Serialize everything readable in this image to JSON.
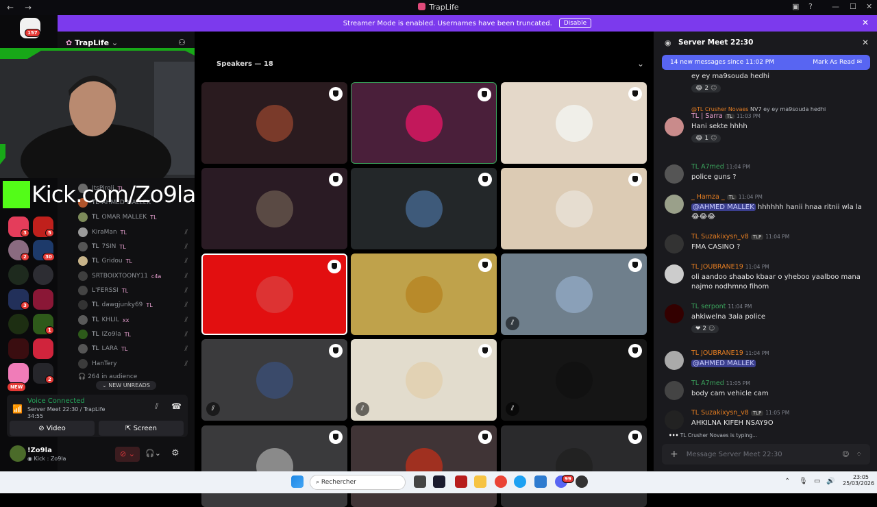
{
  "window": {
    "title": "TrapLife",
    "back": "←",
    "forward": "→",
    "minimize": "—",
    "maximize": "☐",
    "close": "✕"
  },
  "banner": {
    "text": "Streamer Mode is enabled. Usernames have been truncated.",
    "disable_label": "Disable",
    "close": "✕"
  },
  "rail": {
    "home_badge": "157",
    "new_label": "NEW",
    "badges": [
      "3",
      "5",
      "2",
      "30",
      "3",
      "1",
      "2"
    ]
  },
  "guild": {
    "name": "TrapLife"
  },
  "overlay": {
    "kick_text": "Kick.com/Zo9la"
  },
  "stage": {
    "title": "Speakers — 18"
  },
  "members": [
    {
      "prefix": "",
      "name": "ItsPiroli",
      "tag": "TL"
    },
    {
      "prefix": "TL",
      "name": "AHMED MALLEK",
      "tag": ""
    },
    {
      "prefix": "TL",
      "name": "OMAR MALLEK",
      "tag": "TL"
    },
    {
      "prefix": "",
      "name": "KiraMan",
      "tag": "TL"
    },
    {
      "prefix": "TL",
      "name": "7SIN",
      "tag": "TL"
    },
    {
      "prefix": "TL",
      "name": "Gridou",
      "tag": "TL"
    },
    {
      "prefix": "",
      "name": "SRTBOIXTOONY11",
      "tag": "c4a"
    },
    {
      "prefix": "",
      "name": "L'FERSSI",
      "tag": "TL"
    },
    {
      "prefix": "TL",
      "name": "dawgjunky69",
      "tag": "TL"
    },
    {
      "prefix": "TL",
      "name": "KHLIL",
      "tag": "xx"
    },
    {
      "prefix": "TL",
      "name": "IZo9la",
      "tag": "TL"
    },
    {
      "prefix": "TL",
      "name": "LARA",
      "tag": "TL"
    },
    {
      "prefix": "",
      "name": "HanTery",
      "tag": ""
    }
  ],
  "audience": "264 in audience",
  "new_unreads": "NEW UNREADS",
  "voice": {
    "status": "Voice Connected",
    "channel": "Server Meet 22:30 / TrapLife",
    "timer": "34:55",
    "video_label": "Video",
    "screen_label": "Screen"
  },
  "user": {
    "name": "!Zo9la",
    "status": "Kick : Zo9la"
  },
  "chat": {
    "title": "Server Meet 22:30",
    "new_messages": "14 new messages since 11:02 PM",
    "mark_read": "Mark As Read",
    "messages": [
      {
        "text": "ey ey ma9souda hedhi",
        "reaction": "2"
      },
      {
        "reply": "@TL Crusher Novaes",
        "reply_badge": "NV7",
        "reply_text": "ey ey ma9souda hedhi",
        "name": "TL | Sarra",
        "tag": "TL",
        "time": "11:03 PM",
        "text": "Hani sekte hhhh",
        "reaction": "1"
      },
      {
        "name": "TL A7med",
        "time": "11:04 PM",
        "text": "police guns ?"
      },
      {
        "name": "_ Hamza _",
        "tag": "TL",
        "time": "11:04 PM",
        "mention": "@AHMED MALLEK",
        "text": " hhhhhh hanii hnaa ritnii wla la",
        "emoji": "😂😂😂"
      },
      {
        "name": "TL Suzakixysn_v8",
        "tag": "TLP",
        "time": "11:04 PM",
        "text": "FMA CASINO ?"
      },
      {
        "name": "TL JOUBRANE19",
        "time": "11:04 PM",
        "text": "oli aandoo shaabo kbaar o yheboo yaalboo mana najmo nodhmno fihom"
      },
      {
        "name": "TL serpont",
        "time": "11:04 PM",
        "text": "ahkiwelna 3ala police",
        "reaction": "2"
      },
      {
        "name": "TL JOUBRANE19",
        "time": "11:04 PM",
        "mention": "@AHMED MALLEK",
        "text": ""
      },
      {
        "name": "TL A7med",
        "time": "11:05 PM",
        "text": "body cam vehicle cam"
      },
      {
        "name": "TL Suzakixysn_v8",
        "tag": "TLP",
        "time": "11:05 PM",
        "text": "AHKILNA KIFEH NSAY9O"
      }
    ],
    "typing": "TL Crusher Novaes is typing...",
    "composer_placeholder": "Message Server Meet 22:30"
  },
  "taskbar": {
    "search_placeholder": "Rechercher",
    "time": "23:05",
    "date": "25/03/2026",
    "discord_badge": "99"
  },
  "colors": {
    "accent": "#7c3aed",
    "brand": "#5865f2",
    "online": "#23a55a",
    "danger": "#da373c"
  }
}
